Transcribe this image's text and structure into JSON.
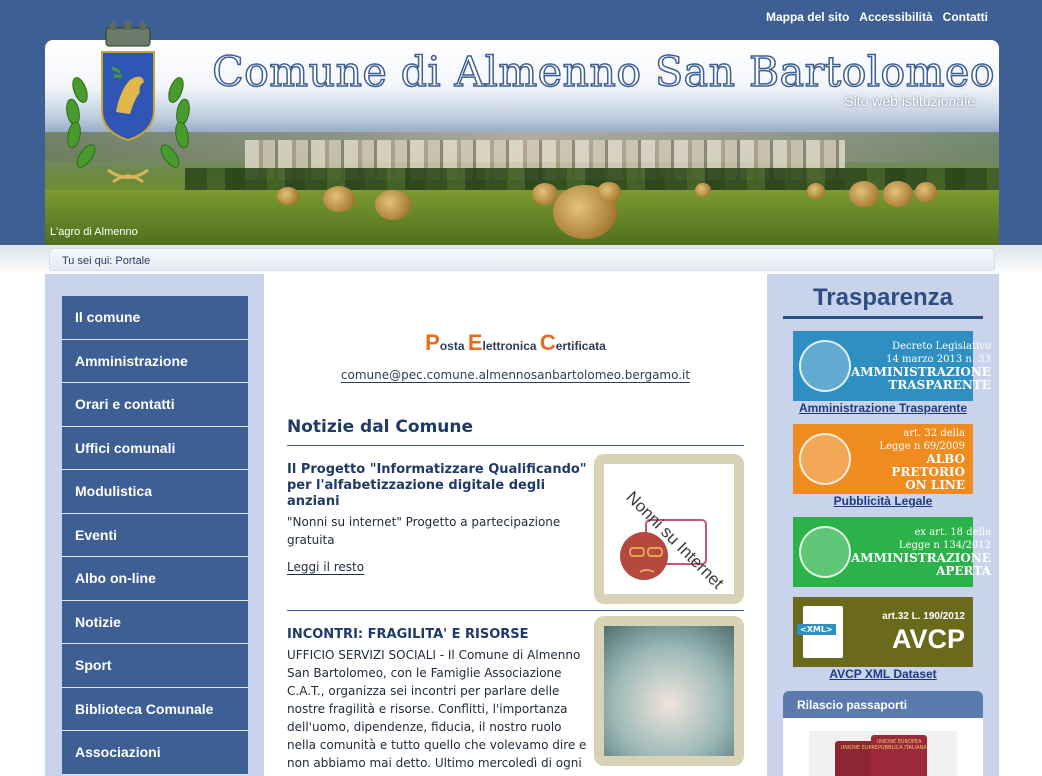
{
  "top_links": {
    "site_map": "Mappa del sito",
    "accessibility": "Accessibilità",
    "contacts": "Contatti"
  },
  "banner": {
    "title": "Comune di Almenno San Bartolomeo",
    "subtitle": "Sito web istituzionale",
    "caption": "L'agro di Almenno"
  },
  "breadcrumb": {
    "text": "Tu sei qui: Portale"
  },
  "left_nav": [
    {
      "label": "Il comune"
    },
    {
      "label": "Amministrazione"
    },
    {
      "label": "Orari e contatti"
    },
    {
      "label": "Uffici comunali"
    },
    {
      "label": "Modulistica"
    },
    {
      "label": "Eventi"
    },
    {
      "label": "Albo on-line"
    },
    {
      "label": "Notizie"
    },
    {
      "label": "Sport"
    },
    {
      "label": "Biblioteca Comunale"
    },
    {
      "label": "Associazioni"
    }
  ],
  "pec": {
    "p_cap": "P",
    "p_rest": "osta ",
    "e_cap": "E",
    "e_rest": "lettronica ",
    "c_cap": "C",
    "c_rest": "ertificata",
    "email": "comune@pec.comune.almennosanbartolomeo.bergamo.it"
  },
  "news": {
    "heading_bold": "Notizie",
    "heading_rest": " dal Comune",
    "items": [
      {
        "title": "Il Progetto \"Informatizzare Qualificando\" per l'alfabetizzazione digitale degli anziani",
        "text": "\"Nonni su internet\" Progetto a partecipazione gratuita",
        "read_more": "Leggi il resto",
        "image_text": "Nonni su Internet"
      },
      {
        "title": "INCONTRI: FRAGILITA' E RISORSE",
        "text": "UFFICIO SERVIZI SOCIALI - Il Comune di Almenno San Bartolomeo, con le Famiglie Associazione C.A.T., organizza sei incontri per parlare delle nostre fragilità e risorse. Conflitti, l'importanza dell'uomo, dipendenze, fiducia, il nostro ruolo nella comunità e tutto quello che volevamo dire e non abbiamo mai detto. Ultimo mercoledì di ogni mese"
      }
    ]
  },
  "transparency": {
    "title": "Trasparenza",
    "badges": [
      {
        "lines": [
          "Decreto Legislativo",
          "14 marzo 2013 n. 33"
        ],
        "strong": [
          "AMMINISTRAZIONE",
          "TRASPARENTE"
        ],
        "link": "Amministrazione Trasparente",
        "color": "#2e8fc0"
      },
      {
        "lines": [
          "art. 32 della",
          "Legge n 69/2009"
        ],
        "strong": [
          "ALBO PRETORIO",
          "ON LINE"
        ],
        "link": "Pubblicità Legale",
        "color": "#ef8b1f"
      },
      {
        "lines": [
          "ex art. 18 della",
          "Legge n 134/2012"
        ],
        "strong": [
          "AMMINISTRAZIONE",
          "APERTA"
        ],
        "link": "",
        "color": "#2bb34a"
      },
      {
        "lines": [
          "art.32 L. 190/2012"
        ],
        "strong": [
          "AVCP"
        ],
        "icon_label": "<XML>",
        "link": "AVCP XML Dataset",
        "color": "#6b6a1c"
      }
    ],
    "passport_title": "Rilascio passaporti",
    "passport_words": [
      "UNIONE EUROPEA",
      "REPUBBLICA ITALIANA"
    ]
  },
  "colors": {
    "brand_blue": "#3d5f93",
    "pec_orange": "#e86c1a",
    "page_bg": "#c9d4ec"
  }
}
